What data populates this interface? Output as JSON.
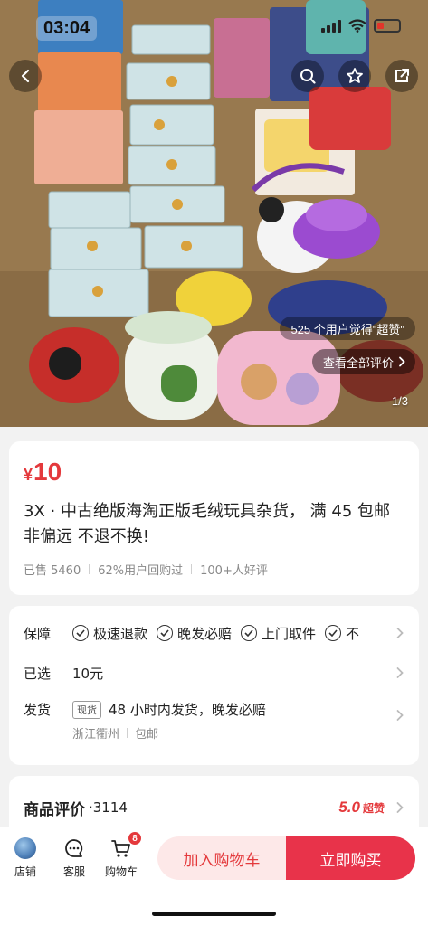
{
  "status": {
    "time": "03:04"
  },
  "hero": {
    "praise_text": "525 个用户觉得\"超赞\"",
    "view_all_reviews": "查看全部评价",
    "page_indicator": "1/3"
  },
  "product": {
    "currency": "¥",
    "price": "10",
    "title": "3X · 中古绝版海淘正版毛绒玩具杂货， 满 45 包邮非偏远 不退不换!",
    "stats": [
      "已售 5460",
      "62%用户回购过",
      "100+人好评"
    ]
  },
  "service": {
    "guarantee_label": "保障",
    "guarantees": [
      "极速退款",
      "晚发必赔",
      "上门取件",
      "不"
    ],
    "selected_label": "已选",
    "selected_value": "10元",
    "shipping_label": "发货",
    "shipping_badge": "现货",
    "shipping_text": "48 小时内发货，晚发必赔",
    "origin": "浙江衢州",
    "postage": "包邮"
  },
  "review": {
    "title": "商品评价",
    "count": "·3114",
    "score": "5.0",
    "score_label": "超赞"
  },
  "bottom": {
    "shop": "店铺",
    "service": "客服",
    "cart": "购物车",
    "cart_count": "8",
    "add_to_cart": "加入购物车",
    "buy_now": "立即购买"
  },
  "colors": {
    "accent": "#e4393c",
    "buy": "#e8334a",
    "add_bg": "#fde8e8"
  }
}
